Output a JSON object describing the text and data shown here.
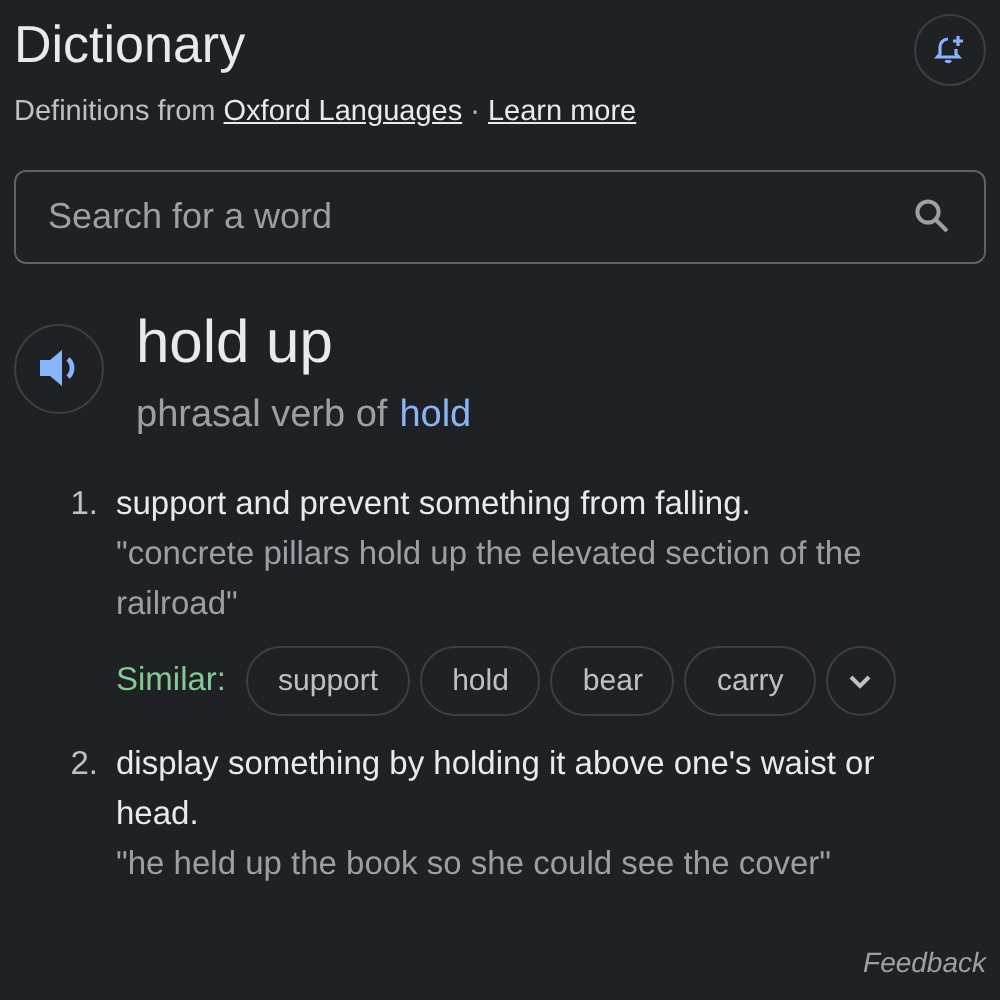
{
  "header": {
    "title": "Dictionary",
    "source_prefix": "Definitions from",
    "source_link": "Oxford Languages",
    "separator": "·",
    "learn_more": "Learn more"
  },
  "search": {
    "placeholder": "Search for a word"
  },
  "entry": {
    "word": "hold up",
    "pos": "phrasal verb of",
    "root": "hold"
  },
  "senses": [
    {
      "number": "1.",
      "definition": "support and prevent something from falling.",
      "example": "\"concrete pillars hold up the elevated section of the railroad\"",
      "similar_label": "Similar:",
      "similar": [
        "support",
        "hold",
        "bear",
        "carry"
      ]
    },
    {
      "number": "2.",
      "definition": "display something by holding it above one's waist or head.",
      "example": "\"he held up the book so she could see the cover\""
    }
  ],
  "feedback": "Feedback"
}
